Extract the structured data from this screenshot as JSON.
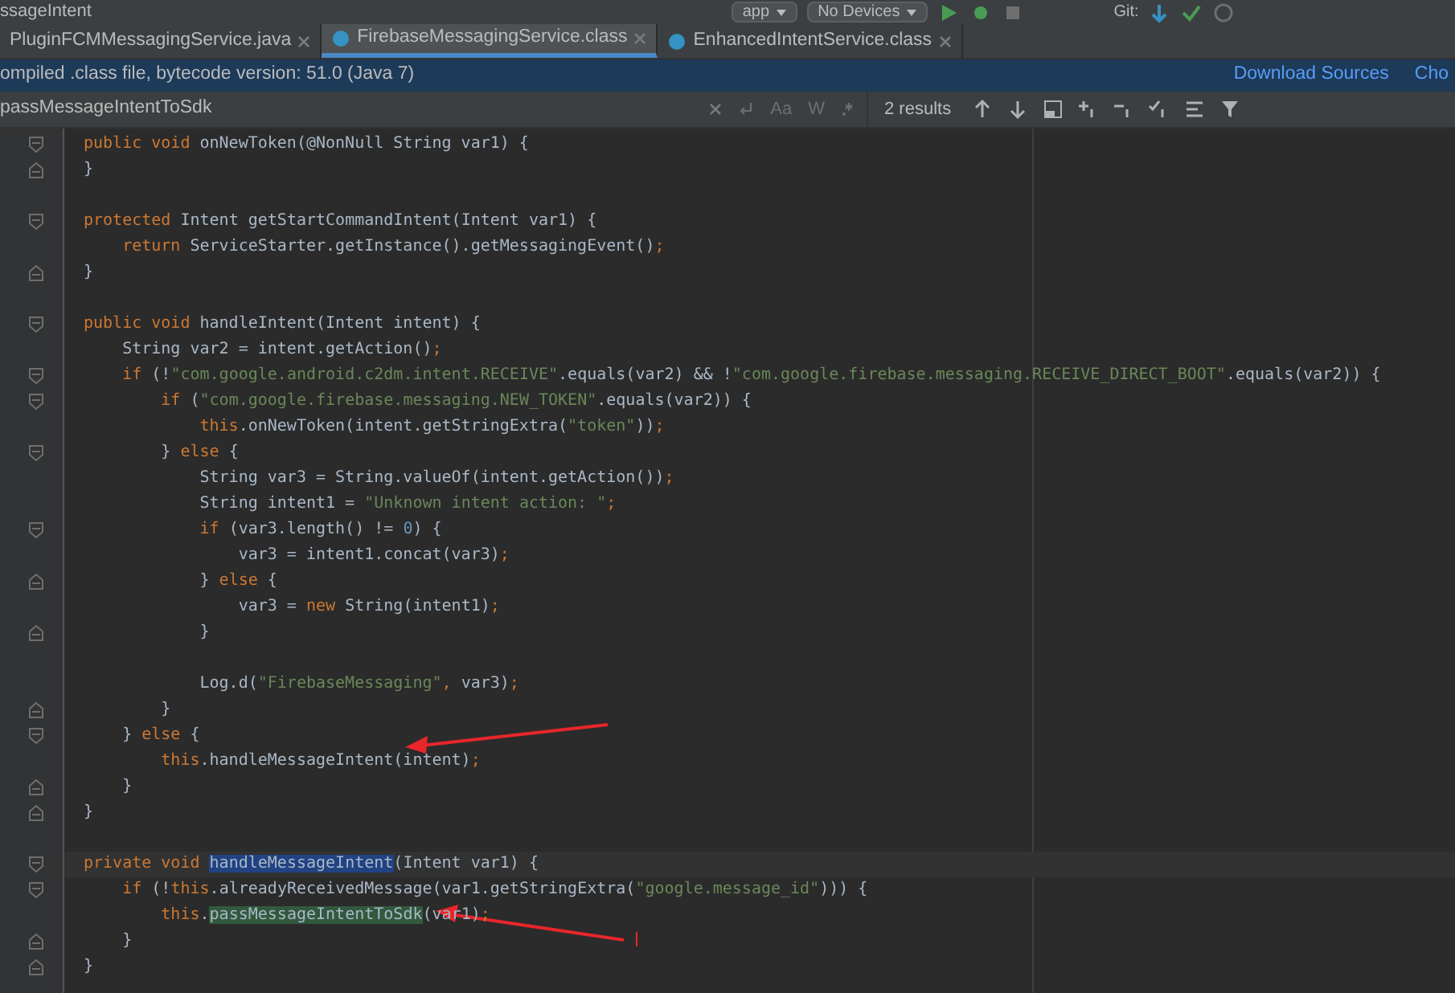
{
  "toolbar": {
    "title": "ssageIntent",
    "run_config": "app",
    "device": "No Devices",
    "vcs_label": "Git:"
  },
  "tabs": [
    {
      "label": "PluginFCMMessagingService.java",
      "kind": "java",
      "selected": false
    },
    {
      "label": "FirebaseMessagingService.class",
      "kind": "class",
      "selected": true
    },
    {
      "label": "EnhancedIntentService.class",
      "kind": "class",
      "selected": false
    }
  ],
  "banner": {
    "text": "ompiled .class file, bytecode version: 51.0 (Java 7)",
    "links": [
      "Download Sources",
      "Cho"
    ]
  },
  "search": {
    "query": "passMessageIntentToSdk",
    "options": [
      "Aa",
      "W"
    ],
    "results": "2 results"
  },
  "code": {
    "lines": [
      {
        "kind": "fold_start",
        "tokens": [
          {
            "kind": "kw",
            "t": "public void "
          },
          {
            "kind": "plain",
            "t": "onNewToken(@NonNull String var1) {"
          }
        ]
      },
      {
        "kind": "fold_end",
        "tokens": [
          {
            "kind": "plain",
            "t": "}"
          }
        ]
      },
      {
        "kind": "blank"
      },
      {
        "kind": "fold_start",
        "tokens": [
          {
            "kind": "kw",
            "t": "protected "
          },
          {
            "kind": "plain",
            "t": "Intent getStartCommandIntent(Intent var1) {"
          }
        ]
      },
      {
        "kind": "plain",
        "tokens": [
          {
            "kind": "kw",
            "t": "    return "
          },
          {
            "kind": "plain",
            "t": "ServiceStarter.getInstance().getMessagingEvent()"
          },
          {
            "kind": "kw",
            "t": ";"
          }
        ]
      },
      {
        "kind": "fold_end",
        "tokens": [
          {
            "kind": "plain",
            "t": "}"
          }
        ]
      },
      {
        "kind": "blank"
      },
      {
        "kind": "fold_start",
        "tokens": [
          {
            "kind": "kw",
            "t": "public void "
          },
          {
            "kind": "plain",
            "t": "handleIntent(Intent intent) {"
          }
        ]
      },
      {
        "kind": "plain",
        "tokens": [
          {
            "kind": "plain",
            "t": "    String var2 = intent.getAction()"
          },
          {
            "kind": "kw",
            "t": ";"
          }
        ]
      },
      {
        "kind": "fold_start",
        "tokens": [
          {
            "kind": "kw",
            "t": "    if "
          },
          {
            "kind": "plain",
            "t": "(!"
          },
          {
            "kind": "str",
            "t": "\"com.google.android.c2dm.intent.RECEIVE\""
          },
          {
            "kind": "plain",
            "t": ".equals(var2) && !"
          },
          {
            "kind": "str",
            "t": "\"com.google.firebase.messaging.RECEIVE_DIRECT_BOOT\""
          },
          {
            "kind": "plain",
            "t": ".equals(var2)) {"
          }
        ]
      },
      {
        "kind": "fold_start",
        "tokens": [
          {
            "kind": "kw",
            "t": "        if "
          },
          {
            "kind": "plain",
            "t": "("
          },
          {
            "kind": "str",
            "t": "\"com.google.firebase.messaging.NEW_TOKEN\""
          },
          {
            "kind": "plain",
            "t": ".equals(var2)) {"
          }
        ]
      },
      {
        "kind": "plain",
        "tokens": [
          {
            "kind": "kw",
            "t": "            this"
          },
          {
            "kind": "plain",
            "t": ".onNewToken(intent.getStringExtra("
          },
          {
            "kind": "str",
            "t": "\"token\""
          },
          {
            "kind": "plain",
            "t": "))"
          },
          {
            "kind": "kw",
            "t": ";"
          }
        ]
      },
      {
        "kind": "fold_start",
        "tokens": [
          {
            "kind": "plain",
            "t": "        } "
          },
          {
            "kind": "kw",
            "t": "else "
          },
          {
            "kind": "plain",
            "t": "{"
          }
        ]
      },
      {
        "kind": "plain",
        "tokens": [
          {
            "kind": "plain",
            "t": "            String var3 = String.valueOf(intent.getAction())"
          },
          {
            "kind": "kw",
            "t": ";"
          }
        ]
      },
      {
        "kind": "plain",
        "tokens": [
          {
            "kind": "plain",
            "t": "            String intent1 = "
          },
          {
            "kind": "str",
            "t": "\"Unknown intent action: \""
          },
          {
            "kind": "kw",
            "t": ";"
          }
        ]
      },
      {
        "kind": "fold_start",
        "tokens": [
          {
            "kind": "kw",
            "t": "            if "
          },
          {
            "kind": "plain",
            "t": "(var3.length() != "
          },
          {
            "kind": "num",
            "t": "0"
          },
          {
            "kind": "plain",
            "t": ") {"
          }
        ]
      },
      {
        "kind": "plain",
        "tokens": [
          {
            "kind": "plain",
            "t": "                var3 = intent1.concat(var3)"
          },
          {
            "kind": "kw",
            "t": ";"
          }
        ]
      },
      {
        "kind": "fold_end",
        "tokens": [
          {
            "kind": "plain",
            "t": "            } "
          },
          {
            "kind": "kw",
            "t": "else "
          },
          {
            "kind": "plain",
            "t": "{"
          }
        ]
      },
      {
        "kind": "plain",
        "tokens": [
          {
            "kind": "plain",
            "t": "                var3 = "
          },
          {
            "kind": "kw",
            "t": "new "
          },
          {
            "kind": "plain",
            "t": "String(intent1)"
          },
          {
            "kind": "kw",
            "t": ";"
          }
        ]
      },
      {
        "kind": "fold_end",
        "tokens": [
          {
            "kind": "plain",
            "t": "            }"
          }
        ]
      },
      {
        "kind": "blank"
      },
      {
        "kind": "plain",
        "tokens": [
          {
            "kind": "plain",
            "t": "            Log.d("
          },
          {
            "kind": "str",
            "t": "\"FirebaseMessaging\""
          },
          {
            "kind": "kw",
            "t": ", "
          },
          {
            "kind": "plain",
            "t": "var3)"
          },
          {
            "kind": "kw",
            "t": ";"
          }
        ]
      },
      {
        "kind": "fold_end",
        "tokens": [
          {
            "kind": "plain",
            "t": "        }"
          }
        ]
      },
      {
        "kind": "fold_start",
        "tokens": [
          {
            "kind": "plain",
            "t": "    } "
          },
          {
            "kind": "kw",
            "t": "else "
          },
          {
            "kind": "plain",
            "t": "{"
          }
        ]
      },
      {
        "kind": "plain",
        "tokens": [
          {
            "kind": "kw",
            "t": "        this"
          },
          {
            "kind": "plain",
            "t": ".handleMessageIntent(intent)"
          },
          {
            "kind": "kw",
            "t": ";"
          }
        ]
      },
      {
        "kind": "fold_end",
        "tokens": [
          {
            "kind": "plain",
            "t": "    }"
          }
        ]
      },
      {
        "kind": "fold_end",
        "tokens": [
          {
            "kind": "plain",
            "t": "}"
          }
        ]
      },
      {
        "kind": "blank"
      },
      {
        "kind": "fold_start",
        "current": true,
        "tokens": [
          {
            "kind": "kw",
            "t": "private void "
          },
          {
            "kind": "sel",
            "t": "handleMessageIntent"
          },
          {
            "kind": "plain",
            "t": "(Intent var1) {"
          }
        ]
      },
      {
        "kind": "fold_start",
        "tokens": [
          {
            "kind": "kw",
            "t": "    if "
          },
          {
            "kind": "plain",
            "t": "(!"
          },
          {
            "kind": "kw",
            "t": "this"
          },
          {
            "kind": "plain",
            "t": ".alreadyReceivedMessage(var1.getStringExtra("
          },
          {
            "kind": "str",
            "t": "\"google.message_id\""
          },
          {
            "kind": "plain",
            "t": "))) {"
          }
        ]
      },
      {
        "kind": "plain",
        "tokens": [
          {
            "kind": "kw",
            "t": "        this"
          },
          {
            "kind": "plain",
            "t": "."
          },
          {
            "kind": "match",
            "t": "passMessageIntentToSdk"
          },
          {
            "kind": "plain",
            "t": "(var1)"
          },
          {
            "kind": "kw",
            "t": ";"
          }
        ]
      },
      {
        "kind": "fold_end",
        "tokens": [
          {
            "kind": "plain",
            "t": "    }"
          }
        ]
      },
      {
        "kind": "fold_end",
        "tokens": [
          {
            "kind": "plain",
            "t": "}"
          }
        ]
      }
    ]
  }
}
